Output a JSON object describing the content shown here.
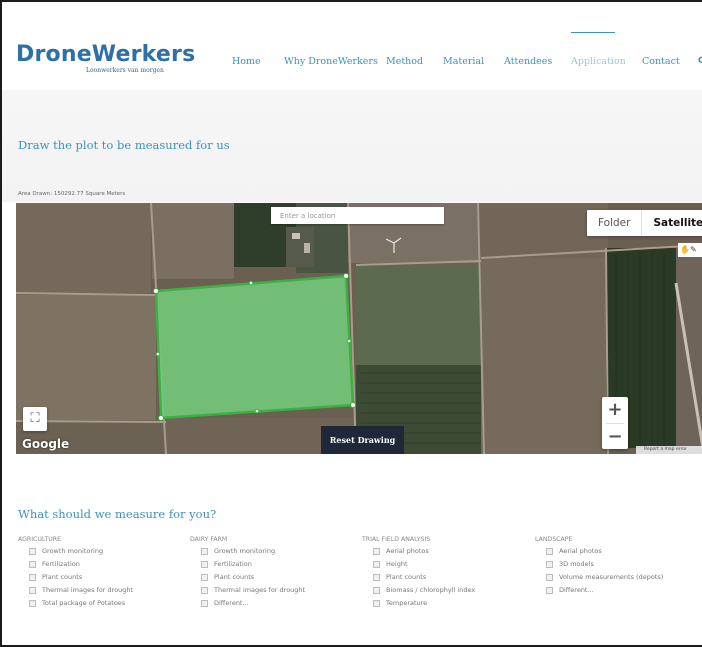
{
  "header": {
    "logo_text": "DroneWerkers",
    "logo_tagline": "Loonwerkers van morgen",
    "nav": [
      {
        "label": "Home",
        "active": false
      },
      {
        "label": "Why DroneWerkers",
        "active": false
      },
      {
        "label": "Method",
        "active": false
      },
      {
        "label": "Material",
        "active": false
      },
      {
        "label": "Attendees",
        "active": false
      },
      {
        "label": "Application",
        "active": true
      },
      {
        "label": "Contact",
        "active": false
      }
    ],
    "nav_more": "C"
  },
  "draw_section": {
    "title": "Draw the plot to be measured for us",
    "area_text": "Area Drawn: 150292.77 Square Meters"
  },
  "map": {
    "location_placeholder": "Enter a location",
    "map_types": [
      "Folder",
      "Satellite"
    ],
    "selected_map_type": "Satellite",
    "tools_icons": [
      "hand-icon",
      "draw-icon"
    ],
    "zoom_in": "+",
    "zoom_out": "−",
    "fullscreen_symbol": "⛶",
    "google_label": "Google",
    "reset_label": "Reset Drawing",
    "report_link": "Report a map error",
    "colors": {
      "polygon_fill": "#74c77a",
      "polygon_stroke": "#3cb043",
      "reset_bg": "#1e2838"
    }
  },
  "measure_section": {
    "title": "What should we measure for you?",
    "columns": [
      {
        "category": "AGRICULTURE",
        "options": [
          "Growth monitoring",
          "Fertilization",
          "Plant counts",
          "Thermal images for drought",
          "Total package of Potatoes"
        ]
      },
      {
        "category": "DAIRY FARM",
        "options": [
          "Growth monitoring",
          "Fertilization",
          "Plant counts",
          "Thermal images for drought",
          "Different..."
        ]
      },
      {
        "category": "TRIAL FIELD ANALYSIS",
        "options": [
          "Aerial photos",
          "Height",
          "Plant counts",
          "Biomass / chlorophyll index",
          "Temperature"
        ]
      },
      {
        "category": "LANDSCAPE",
        "options": [
          "Aerial photos",
          "3D models",
          "Volume measurements (depots)",
          "Different..."
        ]
      }
    ]
  },
  "colors": {
    "accent": "#3a93b8",
    "logo": "#2f6fa8"
  }
}
